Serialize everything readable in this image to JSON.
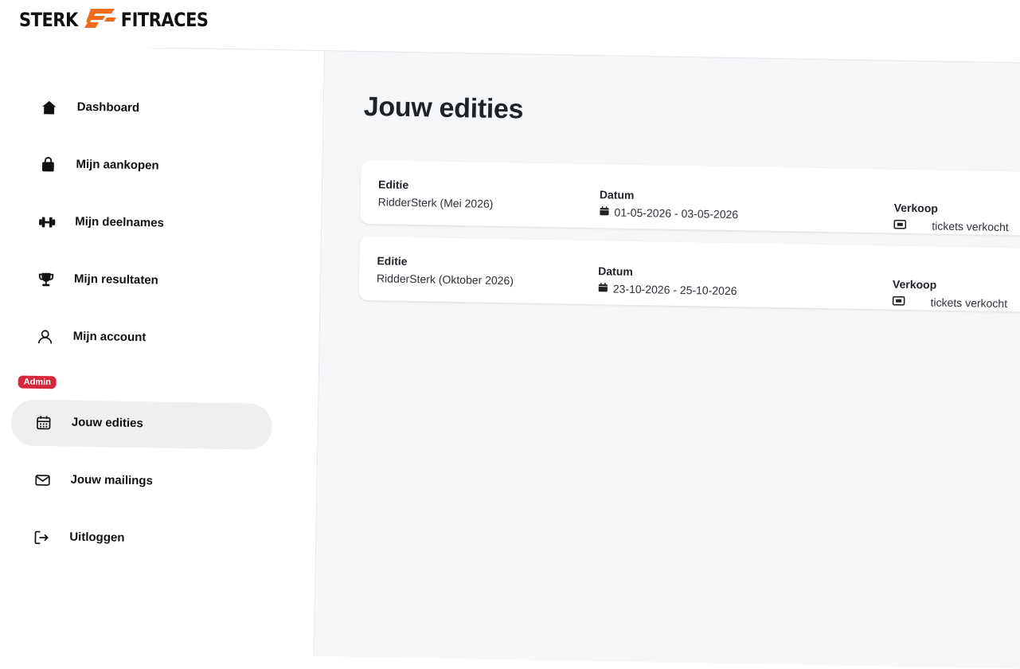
{
  "brand": {
    "left": "STERK",
    "right": "FITRACES",
    "accent": "#f26b1d"
  },
  "sidebar": {
    "items": [
      {
        "label": "Dashboard",
        "icon": "home-icon"
      },
      {
        "label": "Mijn aankopen",
        "icon": "shopping-bag-icon"
      },
      {
        "label": "Mijn deelnames",
        "icon": "dumbbell-icon"
      },
      {
        "label": "Mijn resultaten",
        "icon": "trophy-icon"
      },
      {
        "label": "Mijn account",
        "icon": "user-icon"
      },
      {
        "label": "Jouw edities",
        "icon": "calendar-icon",
        "active": true
      },
      {
        "label": "Jouw mailings",
        "icon": "envelope-icon"
      },
      {
        "label": "Uitloggen",
        "icon": "logout-icon"
      }
    ],
    "admin_badge": "Admin",
    "admin_color": "#d6283c"
  },
  "main": {
    "title": "Jouw edities",
    "editions": [
      {
        "editie_label": "Editie",
        "editie_value": "RidderSterk (Mei 2026)",
        "datum_label": "Datum",
        "datum_value": "01-05-2026 - 03-05-2026",
        "verkoop_label": "Verkoop",
        "verkoop_value": "tickets verkocht"
      },
      {
        "editie_label": "Editie",
        "editie_value": "RidderSterk (Oktober 2026)",
        "datum_label": "Datum",
        "datum_value": "23-10-2026 - 25-10-2026",
        "verkoop_label": "Verkoop",
        "verkoop_value": "tickets verkocht"
      }
    ]
  }
}
